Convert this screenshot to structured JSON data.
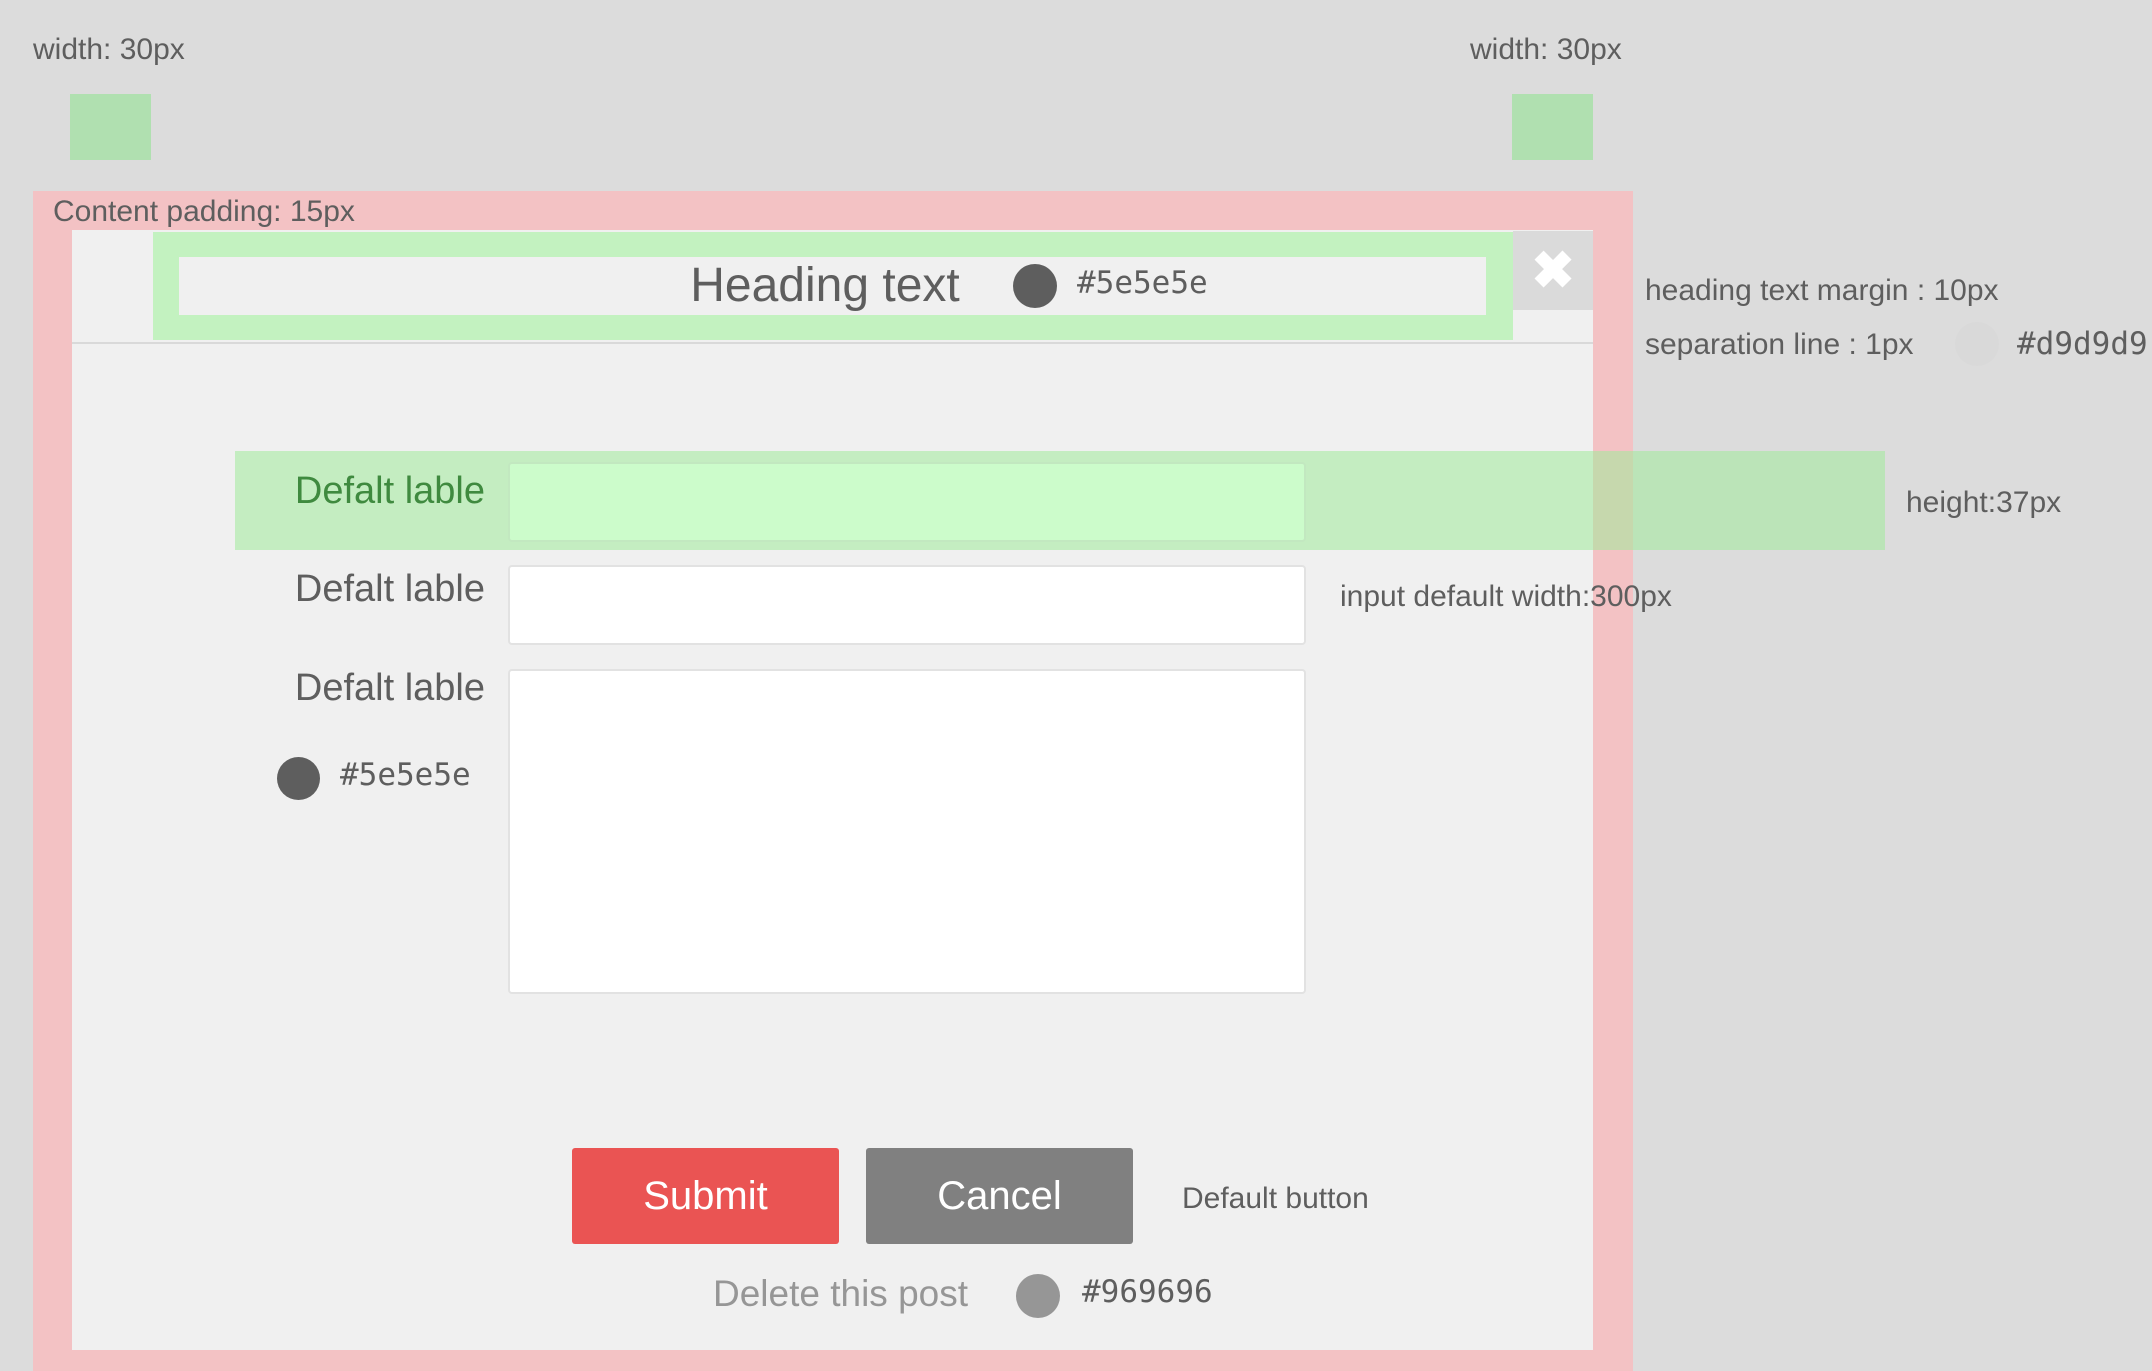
{
  "annotations": {
    "left_width": "width: 30px",
    "right_width": "width: 30px",
    "content_padding": "Content padding: 15px",
    "heading_margin": "heading text margin : 10px",
    "separation_line": "separation line : 1px",
    "separation_color": "#d9d9d9",
    "row_height": "height:37px",
    "input_width": "input default width:300px",
    "default_button": "Default button"
  },
  "modal": {
    "heading": "Heading text",
    "heading_color": "#5e5e5e",
    "close_icon": "close-icon",
    "form": {
      "labels": [
        "Defalt lable",
        "Defalt lable",
        "Defalt lable"
      ],
      "label_color": "#5e5e5e",
      "input_1_value": "",
      "input_2_value": "",
      "textarea_value": ""
    },
    "buttons": {
      "submit": "Submit",
      "cancel": "Cancel"
    },
    "delete_link": "Delete this post",
    "delete_color": "#969696"
  },
  "colors": {
    "submit_bg": "#ea5453",
    "cancel_bg": "#808080",
    "padding_frame": "#f3c2c4",
    "modal_bg": "#f0f0f0"
  }
}
